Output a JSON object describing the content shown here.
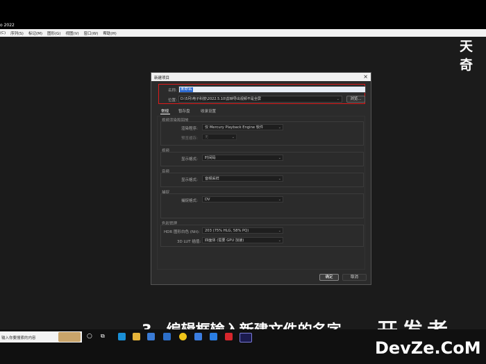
{
  "app_title": "o 2022",
  "menu": [
    "(C)",
    "序列(S)",
    "标记(M)",
    "图形(G)",
    "视图(V)",
    "窗口(W)",
    "帮助(H)"
  ],
  "brand_topright": "天奇",
  "dialog": {
    "title": "新建项目",
    "close": "×",
    "name_label": "名称:",
    "name_value": "未命名",
    "location_label": "位置:",
    "location_value": "D:\\5月\\电子科技\\2022.5.10\\剪映导出视频不是全屏",
    "browse_label": "浏览...",
    "tabs": [
      "常规",
      "暂存盘",
      "收录设置"
    ],
    "groups": {
      "render": {
        "title": "视频渲染和回放",
        "renderer_label": "渲染程序:",
        "renderer_value": "仅 Mercury Playback Engine 软件",
        "preview_cache_label": "预览缓存:",
        "preview_cache_value": "无"
      },
      "video": {
        "title": "视频",
        "display_label": "显示格式:",
        "display_value": "时间码"
      },
      "audio": {
        "title": "音频",
        "display_label": "显示格式:",
        "display_value": "音频采样"
      },
      "capture": {
        "title": "捕捉",
        "format_label": "捕捉格式:",
        "format_value": "DV"
      },
      "color": {
        "title": "色彩管理",
        "hdr_label": "HDR 图形白色 (Nit):",
        "hdr_value": "203 (75% HLG, 58% PQ)",
        "lut_label": "3D LUT 插值:",
        "lut_value": "四面体 (需要 GPU 加速)"
      }
    },
    "ok_label": "确定",
    "cancel_label": "取消"
  },
  "caption": "3、编辑框输入新建文件的名字",
  "watermark_cn": "开发者",
  "watermark_en": "DevZe.CoM",
  "taskbar": {
    "search_placeholder": "输入你要搜索的内容"
  },
  "colors": {
    "annotation_red": "#e01a1a",
    "ok_button": "#3b3b3b",
    "dialog_bg": "#2b2b2b"
  }
}
